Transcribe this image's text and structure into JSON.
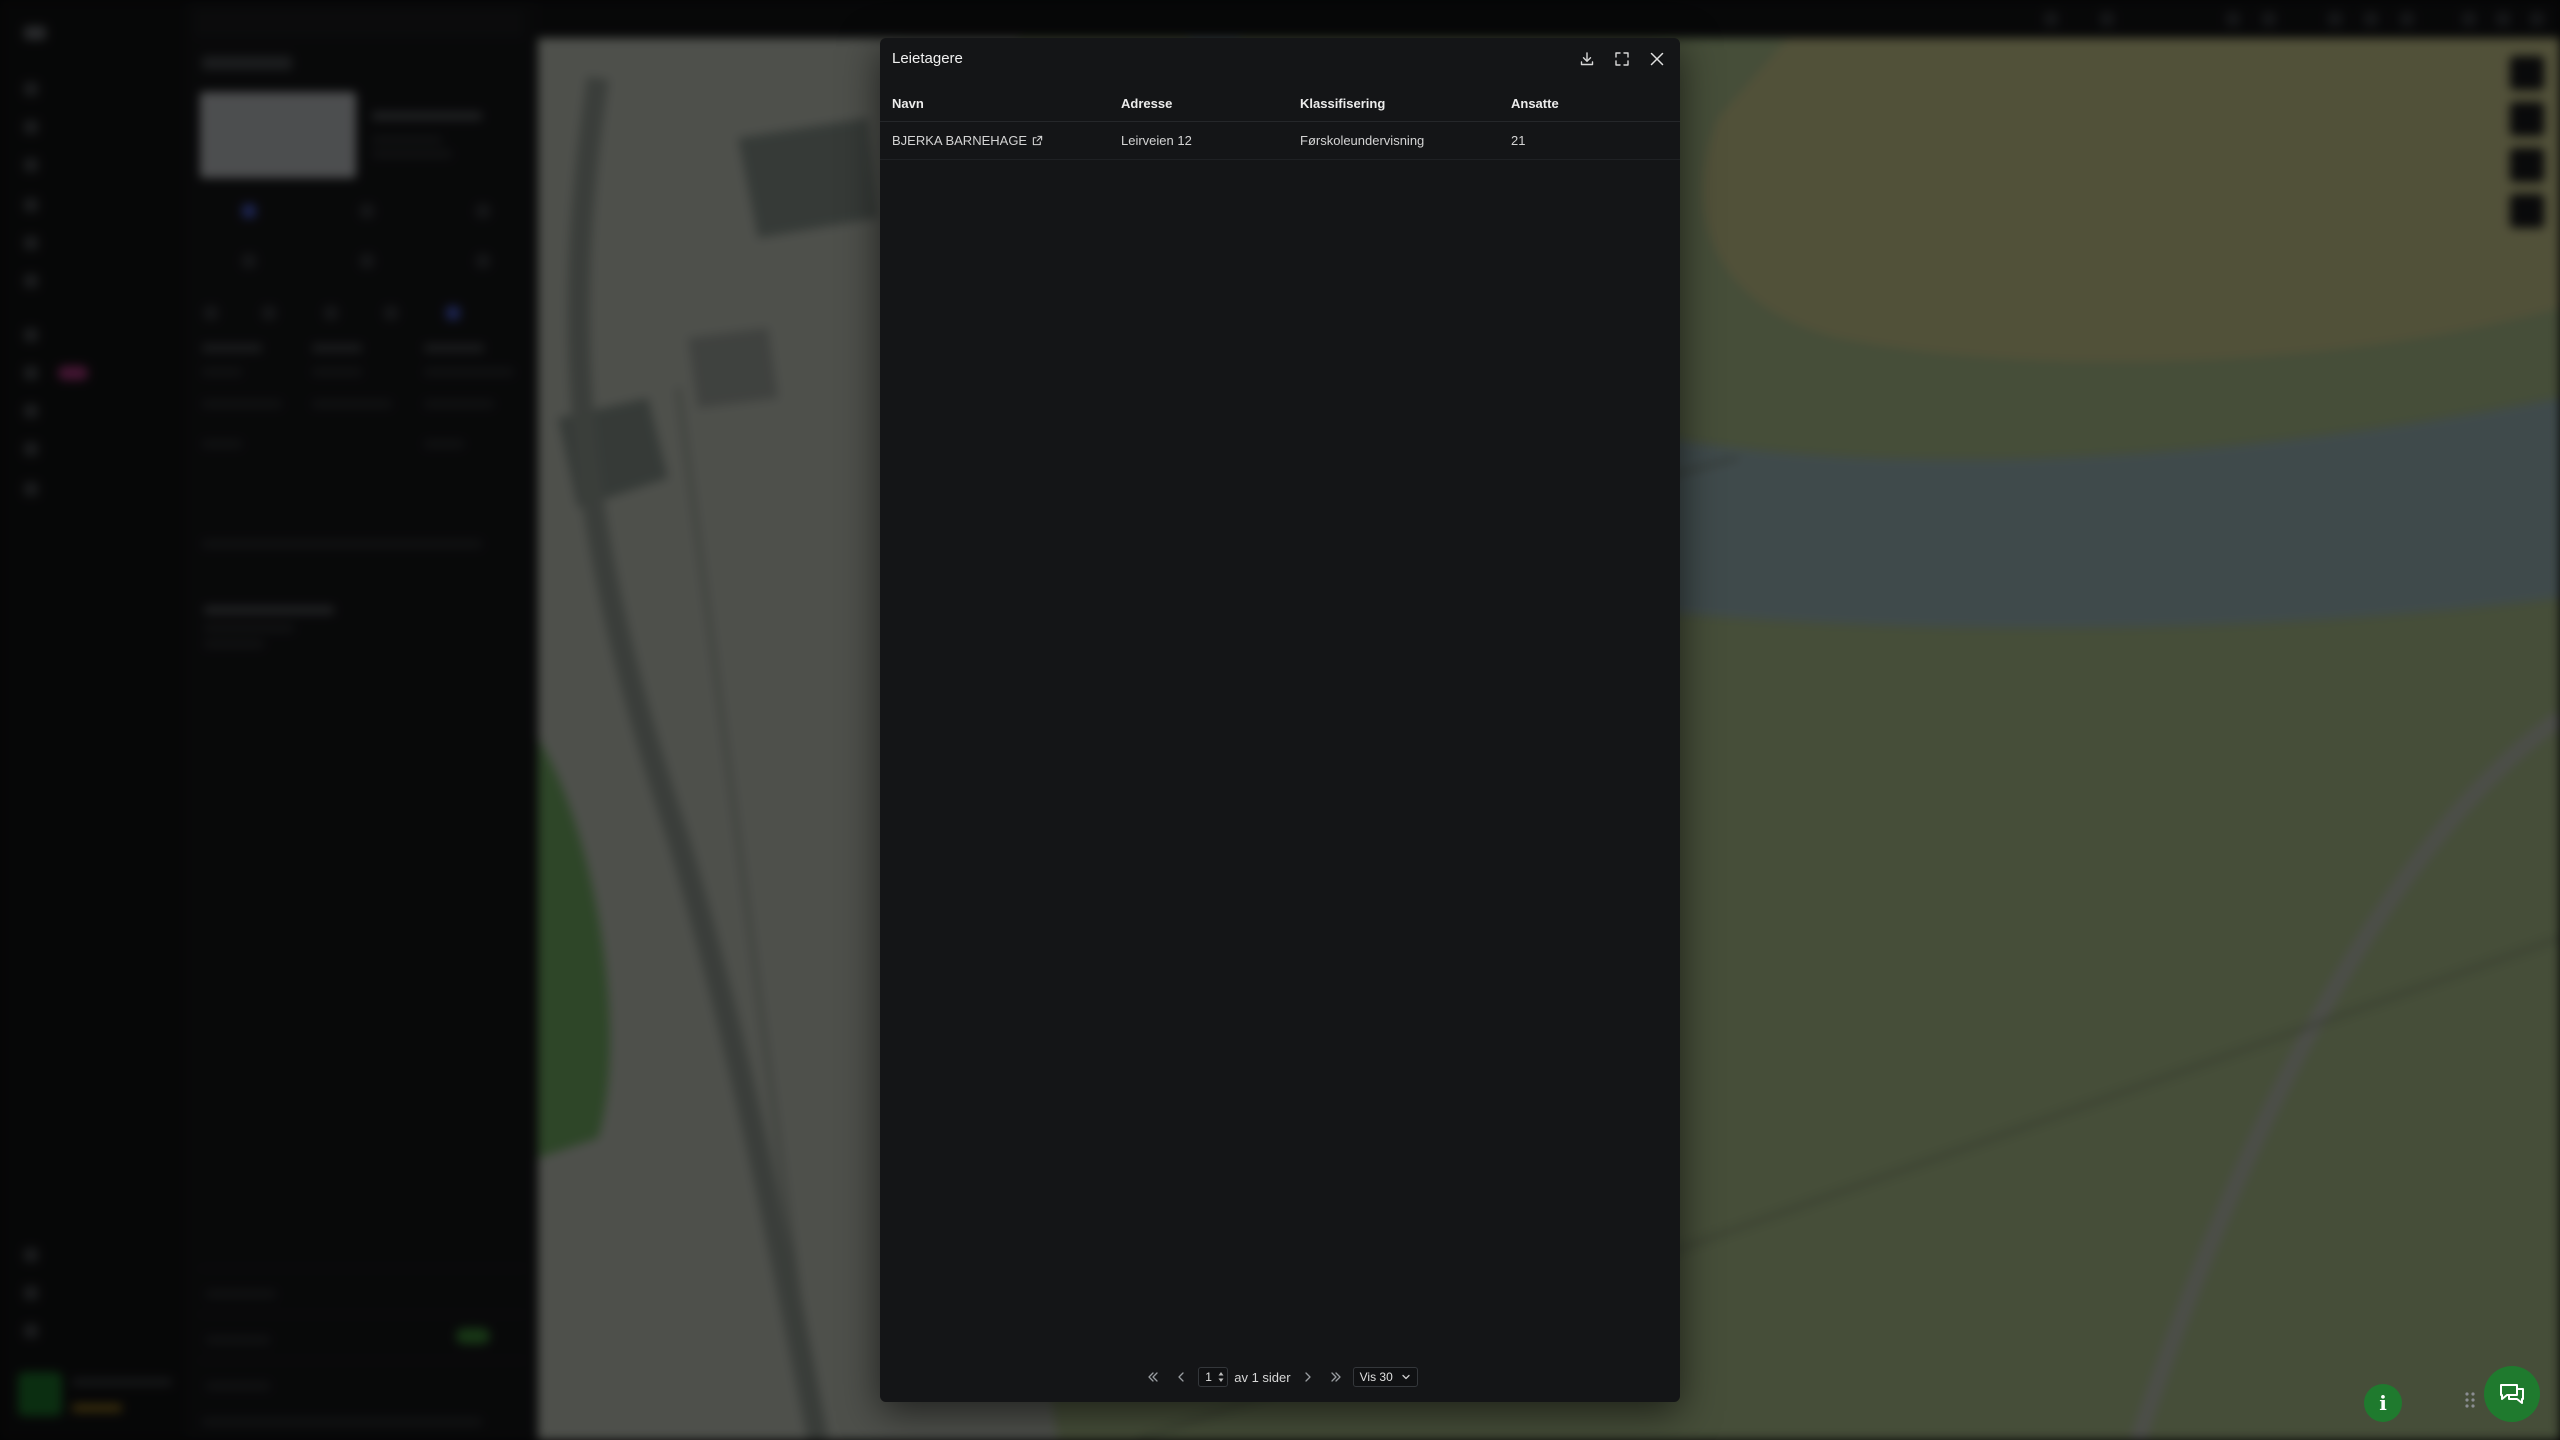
{
  "modal": {
    "title": "Leietagere",
    "columns": {
      "navn": "Navn",
      "adresse": "Adresse",
      "klassifisering": "Klassifisering",
      "ansatte": "Ansatte"
    },
    "rows": [
      {
        "navn": "BJERKA BARNEHAGE",
        "adresse": "Leirveien 12",
        "klassifisering": "Førskoleundervisning",
        "ansatte": "21"
      }
    ],
    "pagination": {
      "current_page": "1",
      "of_pages_label": "av 1 sider",
      "page_size_label": "Vis 30"
    }
  },
  "icons": {
    "download": "download-icon",
    "fullscreen": "fullscreen-icon",
    "close": "close-icon",
    "external_link": "external-link-icon",
    "info": "info-icon",
    "chat": "chat-icon"
  },
  "colors": {
    "accent_green": "#1f7a2e",
    "modal_bg": "#141517"
  }
}
